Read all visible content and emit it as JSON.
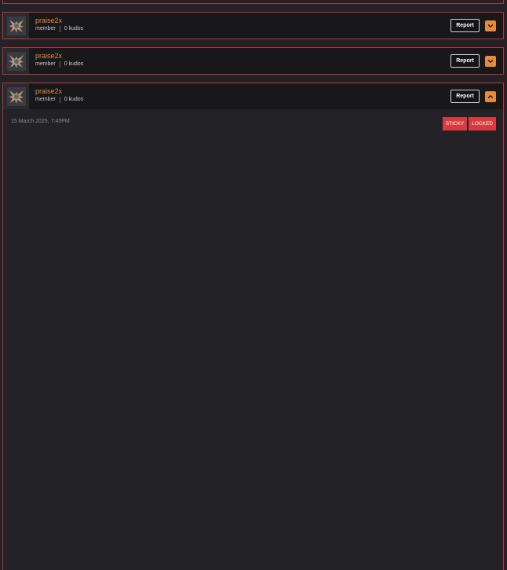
{
  "posts": [
    {
      "username": "praise2x",
      "role": "member",
      "kudos": "0 kudos",
      "report_label": "Report",
      "expanded": false
    },
    {
      "username": "praise2x",
      "role": "member",
      "kudos": "0 kudos",
      "report_label": "Report",
      "expanded": false
    },
    {
      "username": "praise2x",
      "role": "member",
      "kudos": "0 kudos",
      "report_label": "Report",
      "expanded": true,
      "timestamp": "15 March 2025, 7:45PM",
      "badges": [
        "STICKY",
        "LOCKED"
      ]
    }
  ],
  "icons": {
    "avatar": "avatar-icon",
    "collapsed_toggle": "chevron-down-icon",
    "expanded_toggle": "chevron-up-icon"
  },
  "colors": {
    "background": "#232227",
    "header": "#18181b",
    "border": "#b8323b",
    "accent": "#e58b3c",
    "badge": "#d93a3f"
  }
}
